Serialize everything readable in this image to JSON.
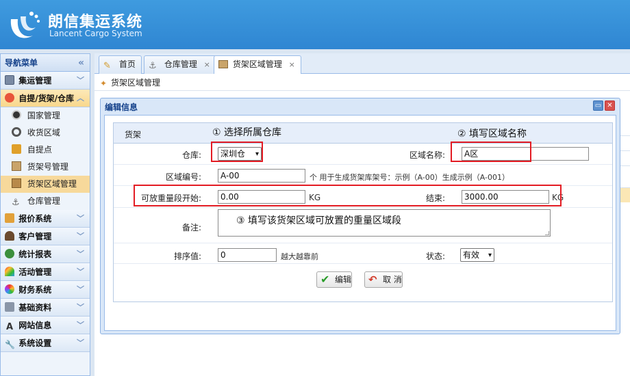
{
  "brand": {
    "title": "朗信集运系统",
    "subtitle": "Lancent Cargo System"
  },
  "sidebar": {
    "header": "导航菜单",
    "collapse": "«",
    "groups": [
      {
        "label": "集运管理",
        "icon": "monitor-icon"
      },
      {
        "label": "自提/货架/仓库",
        "icon": "red-circle-icon"
      },
      {
        "label": "报价系统",
        "icon": "bars-icon"
      },
      {
        "label": "客户管理",
        "icon": "user-icon"
      },
      {
        "label": "统计报表",
        "icon": "globe-icon"
      },
      {
        "label": "活动管理",
        "icon": "rainbow-icon"
      },
      {
        "label": "财务系统",
        "icon": "color-circle-icon"
      },
      {
        "label": "基础资料",
        "icon": "database-icon"
      },
      {
        "label": "网站信息",
        "icon": "font-icon"
      },
      {
        "label": "系统设置",
        "icon": "wrench-icon"
      }
    ],
    "sub_items": [
      {
        "label": "国家管理",
        "icon": "soccer-icon"
      },
      {
        "label": "收货区域",
        "icon": "target-icon"
      },
      {
        "label": "自提点",
        "icon": "lock-icon"
      },
      {
        "label": "货架号管理",
        "icon": "box-icon"
      },
      {
        "label": "货架区域管理",
        "icon": "shelf-icon"
      },
      {
        "label": "仓库管理",
        "icon": "anchor-icon"
      }
    ]
  },
  "tabs": [
    {
      "label": "首页",
      "icon": "home-icon",
      "closable": false
    },
    {
      "label": "仓库管理",
      "icon": "anchor-icon",
      "closable": true
    },
    {
      "label": "货架区域管理",
      "icon": "shelf-icon",
      "closable": true
    }
  ],
  "tab_close": "×",
  "breadcrumb": "货架区域管理",
  "dialog": {
    "title": "编辑信息",
    "section": "货架",
    "fields": {
      "warehouse_label": "仓库:",
      "warehouse_value": "深圳仓",
      "area_name_label": "区域名称:",
      "area_name_value": "A区",
      "area_code_label": "区域编号:",
      "area_code_value": "A-00",
      "area_code_note": "个 用于生成货架库架号：示例（A-00）生成示例（A-001）",
      "weight_start_label": "可放重量段开始:",
      "weight_start_value": "0.00",
      "weight_start_unit": "KG",
      "weight_end_label": "结束:",
      "weight_end_value": "3000.00",
      "weight_end_unit": "KG",
      "remark_label": "备注:",
      "sort_label": "排序值:",
      "sort_value": "0",
      "sort_note": "越大越靠前",
      "status_label": "状态:",
      "status_value": "有效"
    },
    "buttons": {
      "save": "编辑",
      "cancel": "取 消"
    }
  },
  "annotations": {
    "step1": "① 选择所属仓库",
    "step2": "② 填写区域名称",
    "step3": "③ 填写该货架区域可放置的重量区域段"
  },
  "colors": {
    "header": "#2f86d2",
    "highlight": "#e31b23",
    "active_nav": "#f8d78b"
  }
}
